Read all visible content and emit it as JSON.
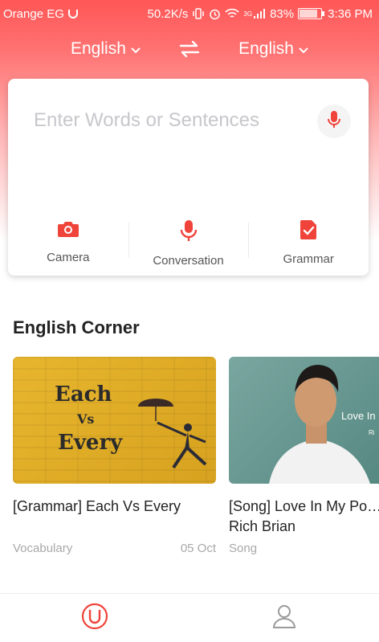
{
  "status_bar": {
    "carrier": "Orange EG",
    "speed": "50.2K/s",
    "network": "3G",
    "battery": "83%",
    "time": "3:36 PM"
  },
  "languages": {
    "source": "English",
    "target": "English"
  },
  "input": {
    "placeholder": "Enter Words or Sentences"
  },
  "tools": [
    {
      "label": "Camera",
      "icon": "camera-icon"
    },
    {
      "label": "Conversation",
      "icon": "microphone-icon"
    },
    {
      "label": "Grammar",
      "icon": "grammar-check-icon"
    }
  ],
  "section": {
    "title": "English Corner"
  },
  "articles": [
    {
      "title": "[Grammar] Each Vs Every",
      "category": "Vocabulary",
      "date": "05 Oct",
      "thumb_words": [
        "Each",
        "Vs",
        "Every"
      ]
    },
    {
      "title": "[Song] Love In My Po… Rich Brian",
      "category": "Song",
      "date": "",
      "thumb_words": [
        "Love In",
        "Ri"
      ]
    }
  ],
  "bottom_nav": [
    {
      "icon": "home-logo-icon"
    },
    {
      "icon": "profile-icon"
    }
  ],
  "colors": {
    "accent": "#f0433a",
    "header_gradient_top": "#ff5656"
  }
}
